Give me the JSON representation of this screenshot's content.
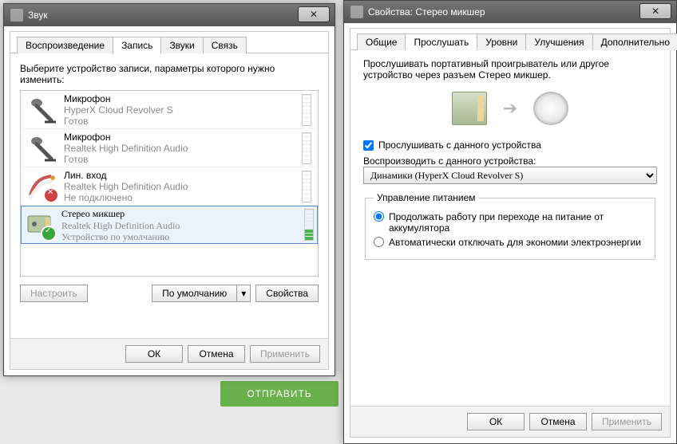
{
  "bgsend_label": "ОТПРАВИТЬ",
  "sound_win": {
    "title": "Звук",
    "close_icon": "✕",
    "tabs": [
      {
        "label": "Воспроизведение",
        "active": false
      },
      {
        "label": "Запись",
        "active": true
      },
      {
        "label": "Звуки",
        "active": false
      },
      {
        "label": "Связь",
        "active": false
      }
    ],
    "instruction": "Выберите устройство записи, параметры которого нужно изменить:",
    "devices": [
      {
        "name": "Микрофон",
        "sub": "HyperX Cloud Revolver S",
        "status": "Готов",
        "state": "ready"
      },
      {
        "name": "Микрофон",
        "sub": "Realtek High Definition Audio",
        "status": "Готов",
        "state": "ready"
      },
      {
        "name": "Лин. вход",
        "sub": "Realtek High Definition Audio",
        "status": "Не подключено",
        "state": "disabled"
      },
      {
        "name": "Стерео микшер",
        "sub": "Realtek High Definition Audio",
        "status": "Устройство по умолчанию",
        "state": "default",
        "selected": true,
        "meter_on": true
      }
    ],
    "configure": "Настроить",
    "set_default": "По умолчанию",
    "properties": "Свойства",
    "ok": "ОК",
    "cancel": "Отмена",
    "apply": "Применить"
  },
  "props_win": {
    "title": "Свойства: Стерео микшер",
    "close_icon": "✕",
    "tabs": [
      {
        "label": "Общие",
        "active": false
      },
      {
        "label": "Прослушать",
        "active": true
      },
      {
        "label": "Уровни",
        "active": false
      },
      {
        "label": "Улучшения",
        "active": false
      },
      {
        "label": "Дополнительно",
        "active": false
      }
    ],
    "description": "Прослушивать портативный проигрыватель или другое устройство через разъем Стерео микшер.",
    "listen_checkbox": "Прослушивать с данного устройства",
    "listen_checked": true,
    "playthrough_label": "Воспроизводить с данного устройства:",
    "playthrough_value": "Динамики (HyperX Cloud Revolver S)",
    "power_group": "Управление питанием",
    "radio1": "Продолжать работу при переходе на питание от аккумулятора",
    "radio2": "Автоматически отключать для экономии электроэнергии",
    "radio_selected": 0,
    "ok": "ОК",
    "cancel": "Отмена",
    "apply": "Применить"
  }
}
